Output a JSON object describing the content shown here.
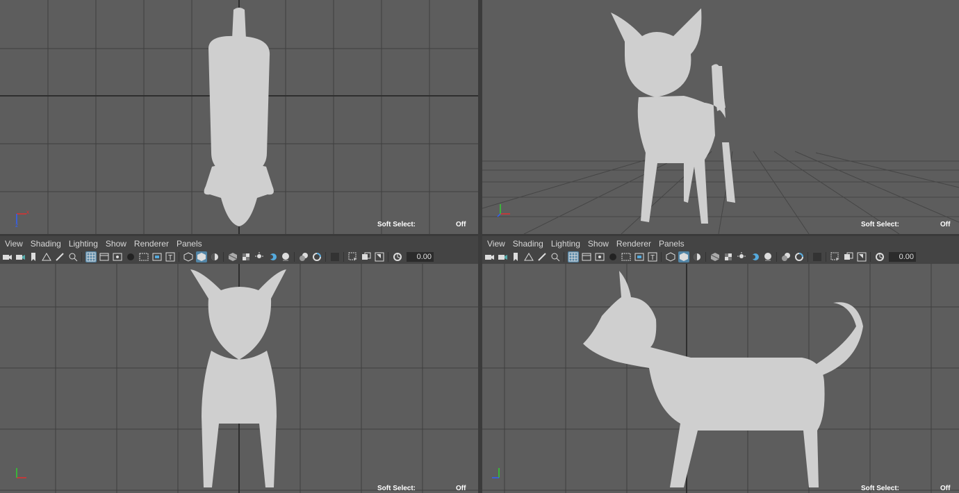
{
  "menu": [
    "View",
    "Shading",
    "Lighting",
    "Show",
    "Renderer",
    "Panels"
  ],
  "toolbar": {
    "icons": [
      "camera-icon",
      "camera-attributes-icon",
      "bookmark-icon",
      "image-plane-icon",
      "grease-pencil-icon",
      "two-d-pan-zoom-icon",
      "grid-icon",
      "film-gate-icon",
      "resolution-gate-icon",
      "gate-mask-icon",
      "field-chart-icon",
      "safe-action-icon",
      "safe-title-icon",
      "wireframe-icon",
      "smooth-shade-icon",
      "default-material-icon",
      "textured-icon",
      "use-all-lights-icon",
      "shadows-icon",
      "ambient-occlusion-icon",
      "motion-blur-icon",
      "anti-aliasing-icon",
      "depth-of-field-icon",
      "isolate-select-icon",
      "xray-icon",
      "xray-active-components-icon",
      "xray-joints-icon",
      "exposure-icon"
    ],
    "exposure_value": "0.00"
  },
  "hud": {
    "soft_select_label": "Soft Select:",
    "soft_select_value": "Off"
  },
  "axis_labels": {
    "x": "x",
    "y": "y",
    "z": "z"
  },
  "colors": {
    "viewport_bg": "#5d5d5d",
    "grid": "#3f3f3f",
    "active_icon": "#5285a6",
    "axis_x": "#e03030",
    "axis_y": "#30d030",
    "axis_z": "#3060ff",
    "model": "#cfcfcf"
  }
}
